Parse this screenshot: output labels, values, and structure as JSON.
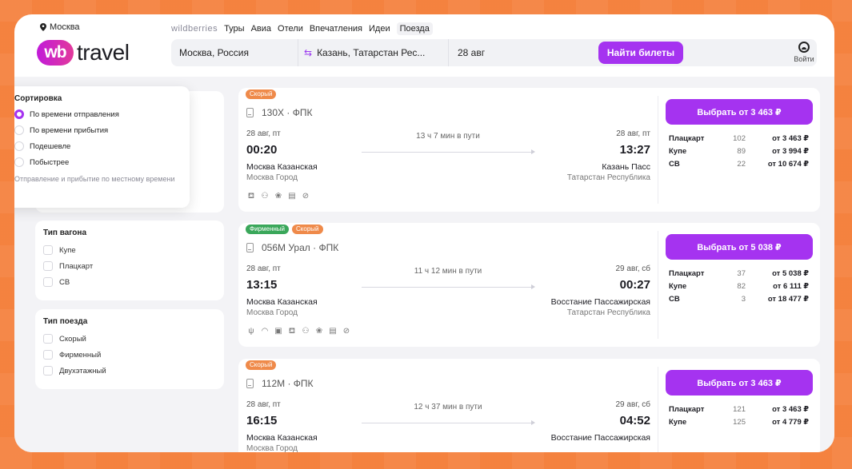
{
  "header": {
    "city": "Москва",
    "logo_wb": "wb",
    "logo_travel": "travel",
    "nav_brand": "wildberries",
    "nav": [
      "Туры",
      "Авиа",
      "Отели",
      "Впечатления",
      "Идеи",
      "Поезда"
    ],
    "nav_active": 5,
    "search": {
      "from": "Москва, Россия",
      "to": "Казань, Татарстан Рес...",
      "date": "28 авг",
      "button": "Найти билеты"
    },
    "login": "Войти"
  },
  "sort": {
    "title": "Сортировка",
    "options": [
      "По времени отправления",
      "По времени прибытия",
      "Подешевле",
      "Побыстрее"
    ],
    "selected": 0,
    "note": "Отправление и прибытие по местному времени"
  },
  "filters": {
    "wagon": {
      "title": "Тип вагона",
      "options": [
        "Купе",
        "Плацкарт",
        "СВ"
      ]
    },
    "train": {
      "title": "Тип поезда",
      "options": [
        "Скорый",
        "Фирменный",
        "Двухэтажный"
      ]
    }
  },
  "trains": [
    {
      "badges": [
        {
          "label": "Скорый",
          "kind": "fast"
        }
      ],
      "number": "130Х · ФПК",
      "dep_date": "28 авг, пт",
      "dep_time": "00:20",
      "arr_date": "28 авг, пт",
      "arr_time": "13:27",
      "duration": "13 ч 7 мин в пути",
      "dep_station": "Москва Казанская",
      "dep_region": "Москва Город",
      "arr_station": "Казань Пасс",
      "arr_region": "Татарстан Республика",
      "amenities": [
        "⛾",
        "⚇",
        "❀",
        "▤",
        "⊘"
      ],
      "button": "Выбрать от 3 463 ₽",
      "prices": [
        {
          "cls": "Плацкарт",
          "cnt": "102",
          "price": "от 3 463 ₽"
        },
        {
          "cls": "Купе",
          "cnt": "89",
          "price": "от 3 994 ₽"
        },
        {
          "cls": "СВ",
          "cnt": "22",
          "price": "от 10 674 ₽"
        }
      ]
    },
    {
      "badges": [
        {
          "label": "Фирменный",
          "kind": "brand"
        },
        {
          "label": "Скорый",
          "kind": "fast"
        }
      ],
      "number": "056М Урал · ФПК",
      "dep_date": "28 авг, пт",
      "dep_time": "13:15",
      "arr_date": "29 авг, сб",
      "arr_time": "00:27",
      "duration": "11 ч 12 мин в пути",
      "dep_station": "Москва Казанская",
      "dep_region": "Москва Город",
      "arr_station": "Восстание Пассажирская",
      "arr_region": "Татарстан Республика",
      "amenities": [
        "ψ",
        "◠",
        "▣",
        "⛾",
        "⚇",
        "❀",
        "▤",
        "⊘"
      ],
      "button": "Выбрать от 5 038 ₽",
      "prices": [
        {
          "cls": "Плацкарт",
          "cnt": "37",
          "price": "от 5 038 ₽"
        },
        {
          "cls": "Купе",
          "cnt": "82",
          "price": "от 6 111 ₽"
        },
        {
          "cls": "СВ",
          "cnt": "3",
          "price": "от 18 477 ₽"
        }
      ]
    },
    {
      "badges": [
        {
          "label": "Скорый",
          "kind": "fast"
        }
      ],
      "number": "112М · ФПК",
      "dep_date": "28 авг, пт",
      "dep_time": "16:15",
      "arr_date": "29 авг, сб",
      "arr_time": "04:52",
      "duration": "12 ч 37 мин в пути",
      "dep_station": "Москва Казанская",
      "dep_region": "Москва Город",
      "arr_station": "Восстание Пассажирская",
      "arr_region": "",
      "amenities": [],
      "button": "Выбрать от 3 463 ₽",
      "prices": [
        {
          "cls": "Плацкарт",
          "cnt": "121",
          "price": "от 3 463 ₽"
        },
        {
          "cls": "Купе",
          "cnt": "125",
          "price": "от 4 779 ₽"
        }
      ]
    }
  ],
  "colors": {
    "accent": "#a533f0",
    "bg": "#f47b35",
    "badge_fast": "#ef8a4a",
    "badge_brand": "#3aa75a"
  }
}
